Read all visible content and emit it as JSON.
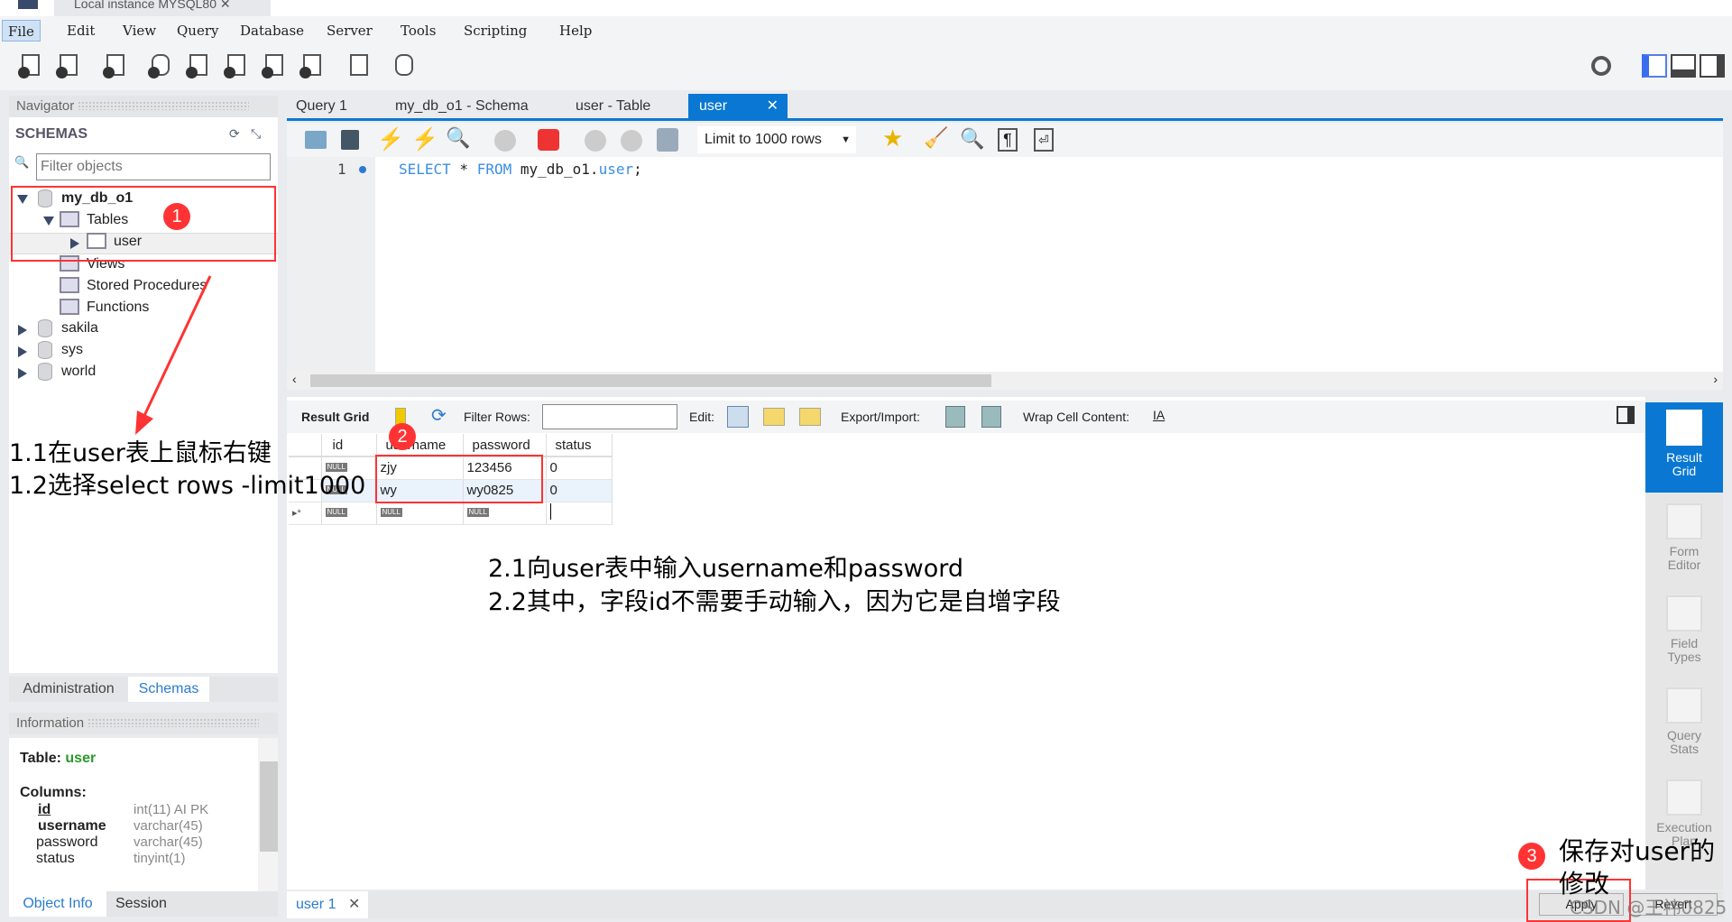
{
  "window": {
    "tab_title": "Local instance MYSQL80"
  },
  "menu": [
    "File",
    "Edit",
    "View",
    "Query",
    "Database",
    "Server",
    "Tools",
    "Scripting",
    "Help"
  ],
  "navigator": {
    "title": "Navigator",
    "schemas_label": "SCHEMAS",
    "filter_placeholder": "Filter objects",
    "tree": {
      "db": "my_db_o1",
      "tables": "Tables",
      "table": "user",
      "views": "Views",
      "procs": "Stored Procedures",
      "funcs": "Functions",
      "others": [
        "sakila",
        "sys",
        "world"
      ]
    },
    "tabs": [
      "Administration",
      "Schemas"
    ]
  },
  "information": {
    "title": "Information",
    "table_label": "Table:",
    "table_name": "user",
    "columns_label": "Columns:",
    "columns": [
      {
        "name": "id",
        "type": "int(11) AI PK"
      },
      {
        "name": "username",
        "type": "varchar(45)"
      },
      {
        "name": "password",
        "type": "varchar(45)"
      },
      {
        "name": "status",
        "type": "tinyint(1)"
      }
    ],
    "tabs": [
      "Object Info",
      "Session"
    ]
  },
  "editor_tabs": [
    "Query 1",
    "my_db_o1 - Schema",
    "user - Table",
    "user"
  ],
  "sql_toolbar": {
    "limit": "Limit to 1000 rows"
  },
  "editor": {
    "line": "1",
    "sql_kw1": "SELECT",
    "sql_star": " * ",
    "sql_kw2": "FROM",
    "sql_schema": " my_db_o1.",
    "sql_table": "user",
    "sql_end": ";"
  },
  "result_toolbar": {
    "result_grid": "Result Grid",
    "filter_rows": "Filter Rows:",
    "edit": "Edit:",
    "export": "Export/Import:",
    "wrap": "Wrap Cell Content:"
  },
  "grid": {
    "headers": [
      "id",
      "username",
      "password",
      "status"
    ],
    "rows": [
      [
        "NULL",
        "zjy",
        "123456",
        "0"
      ],
      [
        "NULL",
        "wy",
        "wy0825",
        "0"
      ]
    ],
    "new_row": [
      "NULL",
      "NULL",
      "NULL",
      ""
    ],
    "null_label": "NULL",
    "new_marker": "▸*"
  },
  "side_panel": [
    {
      "label": "Result Grid",
      "active": true
    },
    {
      "label": "Form Editor"
    },
    {
      "label": "Field Types"
    },
    {
      "label": "Query Stats"
    },
    {
      "label": "Execution Plan"
    }
  ],
  "bottom": {
    "tab": "user 1",
    "apply": "Apply",
    "revert": "Revert"
  },
  "annotations": {
    "b1": "1",
    "b2": "2",
    "b3": "3",
    "a11": "1.1在user表上鼠标右键",
    "a12": "1.2选择select rows -limit1000",
    "a21": "2.1向user表中输入username和password",
    "a22": "2.2其中，字段id不需要手动输入，因为它是自增字段",
    "a31": "保存对user的",
    "a32": "修改",
    "watermark": "CSDN @王祎0825"
  },
  "colors": {
    "accent": "#0a78d2",
    "annotation_red": "#ff3333",
    "sql_keyword": "#3a8ee6"
  }
}
